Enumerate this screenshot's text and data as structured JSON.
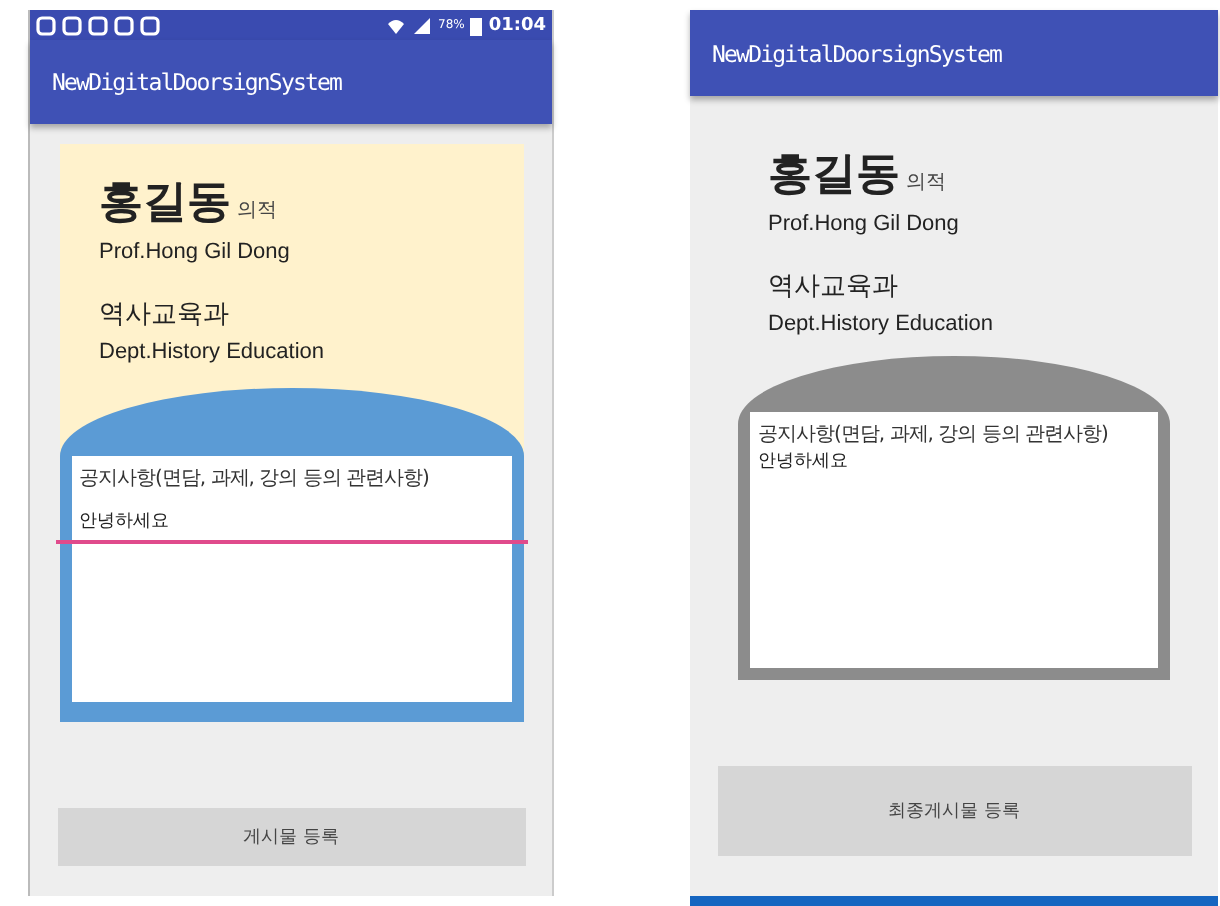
{
  "phones": [
    {
      "kind": "edit",
      "status_bar": {
        "battery": "78%",
        "time": "01:04"
      },
      "app_title": "NewDigitalDoorsignSystem",
      "name": "홍길동",
      "name_suffix": "의적",
      "name_english": "Prof.Hong Gil Dong",
      "department": "역사교육과",
      "department_english": "Dept.History Education",
      "notice_heading": "공지사항(면담, 과제, 강의 등의 관련사항)",
      "notice_text": "안녕하세요",
      "button": "게시물 등록"
    },
    {
      "kind": "final",
      "app_title": "NewDigitalDoorsignSystem",
      "name": "홍길동",
      "name_suffix": "의적",
      "name_english": "Prof.Hong Gil Dong",
      "department": "역사교육과",
      "department_english": "Dept.History Education",
      "notice_heading": "공지사항(면담, 과제, 강의 등의 관련사항)",
      "notice_text": "안녕하세요",
      "button": "최종게시물 등록"
    }
  ]
}
